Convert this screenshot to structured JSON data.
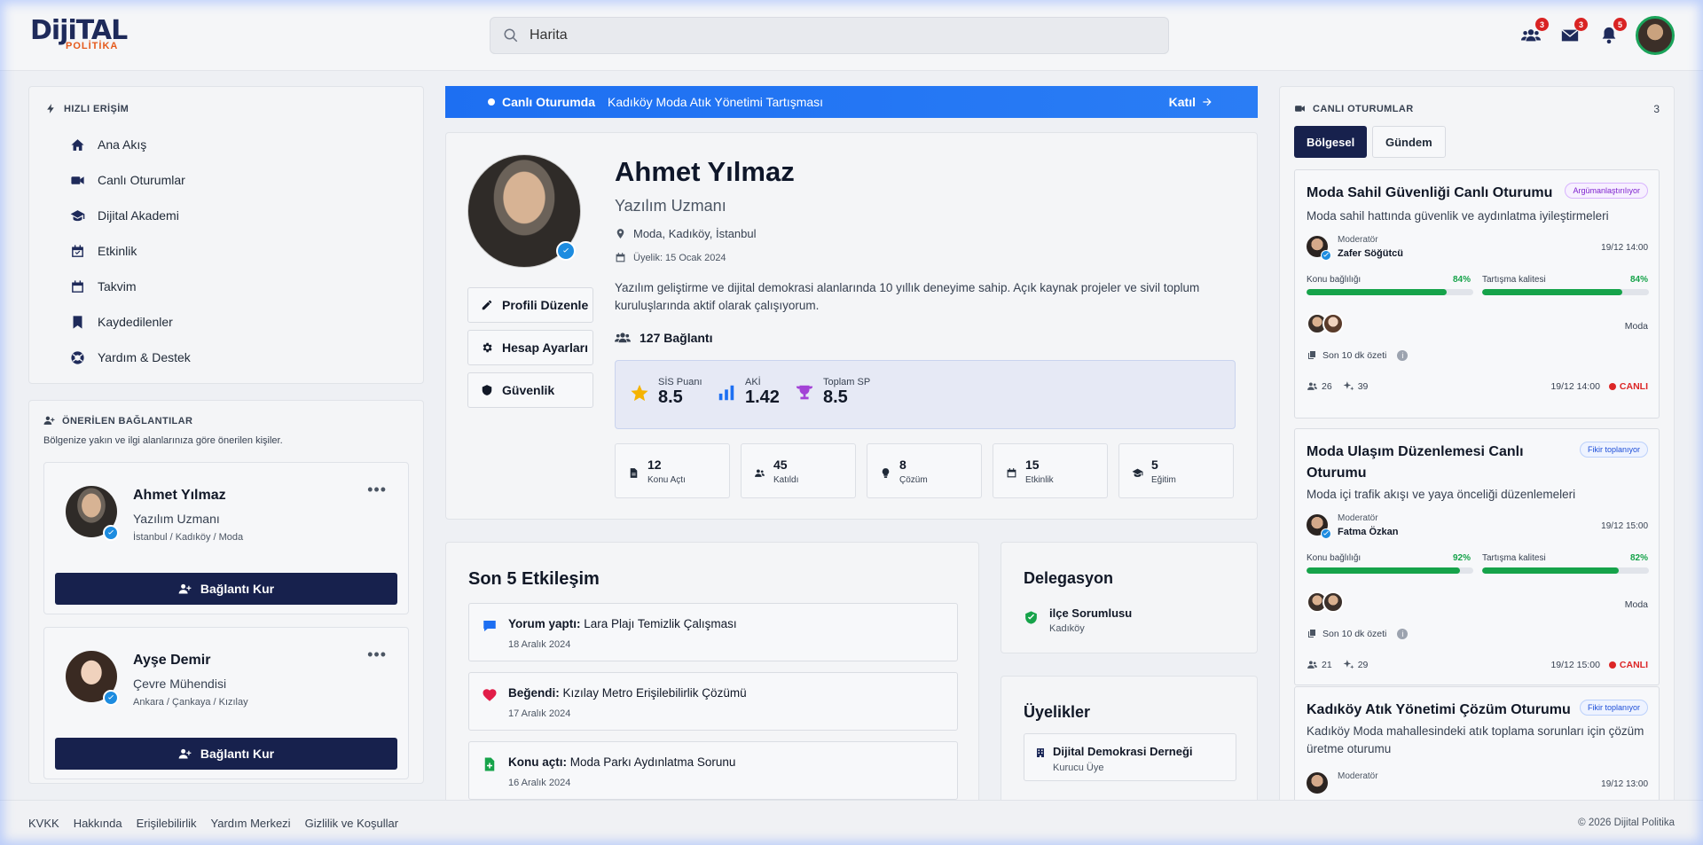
{
  "header": {
    "logo_top": "DijiTAL",
    "logo_bottom": "POLİTİKA",
    "search_value": "Harita",
    "badges": {
      "connections": "3",
      "messages": "3",
      "notifications": "5"
    }
  },
  "quick_access": {
    "title": "HIZLI ERİŞİM",
    "items": [
      {
        "label": "Ana Akış",
        "icon": "home-icon"
      },
      {
        "label": "Canlı Oturumlar",
        "icon": "video-icon"
      },
      {
        "label": "Dijital Akademi",
        "icon": "graduation-cap-icon"
      },
      {
        "label": "Etkinlik",
        "icon": "calendar-check-icon"
      },
      {
        "label": "Takvim",
        "icon": "calendar-icon"
      },
      {
        "label": "Kaydedilenler",
        "icon": "bookmark-icon"
      },
      {
        "label": "Yardım & Destek",
        "icon": "life-ring-icon"
      }
    ]
  },
  "suggestions": {
    "title": "ÖNERİLEN BAĞLANTILAR",
    "subtitle": "Bölgenize yakın ve ilgi alanlarınıza göre önerilen kişiler.",
    "people": [
      {
        "name": "Ahmet Yılmaz",
        "role": "Yazılım Uzmanı",
        "location": "İstanbul / Kadıköy / Moda",
        "button": "Bağlantı Kur"
      },
      {
        "name": "Ayşe Demir",
        "role": "Çevre Mühendisi",
        "location": "Ankara / Çankaya / Kızılay",
        "button": "Bağlantı Kur"
      }
    ]
  },
  "live_banner": {
    "label": "Canlı Oturumda",
    "text": "Kadıköy Moda Atık Yönetimi Tartışması",
    "join": "Katıl"
  },
  "profile": {
    "name": "Ahmet Yılmaz",
    "title": "Yazılım Uzmanı",
    "location": "Moda, Kadıköy, İstanbul",
    "member_since": "Üyelik: 15 Ocak 2024",
    "bio": "Yazılım geliştirme ve dijital demokrasi alanlarında 10 yıllık deneyime sahip. Açık kaynak projeler ve sivil toplum kuruluşlarında aktif olarak çalışıyorum.",
    "connections": "127 Bağlantı",
    "buttons": {
      "edit": "Profili Düzenle",
      "settings": "Hesap Ayarları",
      "security": "Güvenlik"
    },
    "scores": [
      {
        "label": "SİS Puanı",
        "value": "8.5",
        "icon": "star-icon"
      },
      {
        "label": "AKİ",
        "value": "1.42",
        "icon": "bar-chart-icon"
      },
      {
        "label": "Toplam SP",
        "value": "8.5",
        "icon": "trophy-icon"
      }
    ],
    "stats": [
      {
        "n": "12",
        "t": "Konu Açtı",
        "icon": "file-icon"
      },
      {
        "n": "45",
        "t": "Katıldı",
        "icon": "users-icon"
      },
      {
        "n": "8",
        "t": "Çözüm",
        "icon": "lightbulb-icon"
      },
      {
        "n": "15",
        "t": "Etkinlik",
        "icon": "calendar-icon"
      },
      {
        "n": "5",
        "t": "Eğitim",
        "icon": "graduation-cap-icon"
      }
    ]
  },
  "interactions": {
    "title": "Son 5 Etkileşim",
    "items": [
      {
        "type": "Yorum yaptı:",
        "text": "Lara Plajı Temizlik Çalışması",
        "date": "18 Aralık 2024"
      },
      {
        "type": "Beğendi:",
        "text": "Kızılay Metro Erişilebilirlik Çözümü",
        "date": "17 Aralık 2024"
      },
      {
        "type": "Konu açtı:",
        "text": "Moda Parkı Aydınlatma Sorunu",
        "date": "16 Aralık 2024"
      }
    ]
  },
  "delegation": {
    "title": "Delegasyon",
    "role": "ilçe Sorumlusu",
    "area": "Kadıköy"
  },
  "memberships": {
    "title": "Üyelikler",
    "item": "Dijital Demokrasi Derneği",
    "role": "Kurucu Üye"
  },
  "live_sessions": {
    "title": "CANLI OTURUMLAR",
    "count": "3",
    "tabs": [
      "Bölgesel",
      "Gündem"
    ],
    "sessions": [
      {
        "title": "Moda Sahil Güvenliği Canlı Oturumu",
        "tag": "Argümanlaştırılıyor",
        "desc": "Moda sahil hattında güvenlik ve aydınlatma iyileştirmeleri",
        "mod_label": "Moderatör",
        "mod_name": "Zafer Söğütcü",
        "datetime": "19/12 14:00",
        "bar1_label": "Konu bağlılığı",
        "bar1_pct": "84%",
        "bar1_value": 84,
        "bar2_label": "Tartışma kalitesi",
        "bar2_pct": "84%",
        "bar2_value": 84,
        "region": "Moda",
        "summary": "Son 10 dk özeti",
        "participants": "26",
        "sparks": "39",
        "time": "19/12 14:00",
        "live": "CANLI"
      },
      {
        "title": "Moda Ulaşım Düzenlemesi Canlı Oturumu",
        "tag": "Fikir toplanıyor",
        "desc": "Moda içi trafik akışı ve yaya önceliği düzenlemeleri",
        "mod_label": "Moderatör",
        "mod_name": "Fatma Özkan",
        "datetime": "19/12 15:00",
        "bar1_label": "Konu bağlılığı",
        "bar1_pct": "92%",
        "bar1_value": 92,
        "bar2_label": "Tartışma kalitesi",
        "bar2_pct": "82%",
        "bar2_value": 82,
        "region": "Moda",
        "summary": "Son 10 dk özeti",
        "participants": "21",
        "sparks": "29",
        "time": "19/12 15:00",
        "live": "CANLI"
      },
      {
        "title": "Kadıköy Atık Yönetimi Çözüm Oturumu",
        "tag": "Fikir toplanıyor",
        "desc": "Kadıköy Moda mahallesindeki atık toplama sorunları için çözüm üretme oturumu",
        "mod_label": "Moderatör",
        "datetime": "19/12 13:00"
      }
    ]
  },
  "footer": {
    "links": [
      "KVKK",
      "Hakkında",
      "Erişilebilirlik",
      "Yardım Merkezi",
      "Gizlilik ve Koşullar"
    ],
    "copyright": "© 2026 Dijital Politika"
  },
  "colors": {
    "primary": "#17214d",
    "banner_blue": "#1d6ff2",
    "success": "#16a34a",
    "live_red": "#dc2626",
    "logo_orange": "#e55a1c"
  }
}
